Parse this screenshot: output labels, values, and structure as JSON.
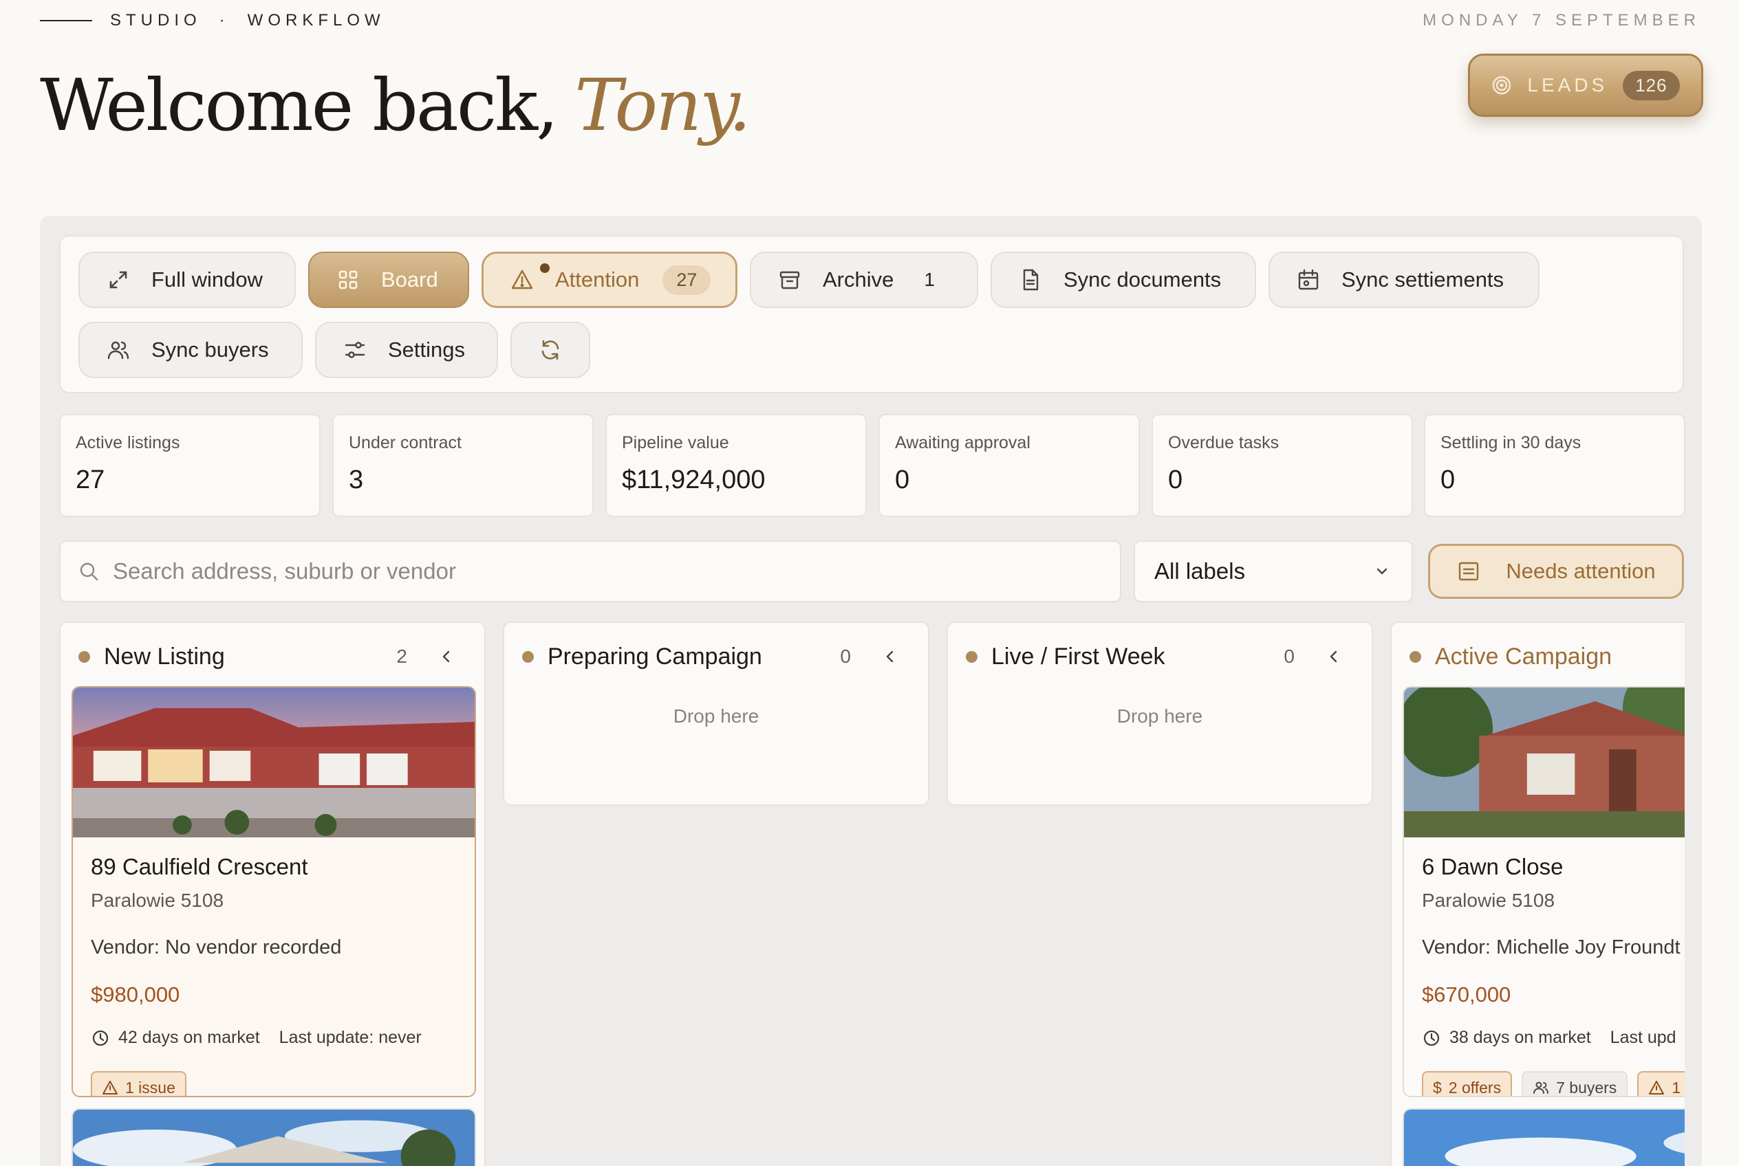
{
  "header": {
    "eyebrow_left": "STUDIO",
    "eyebrow_sep": "·",
    "eyebrow_right": "WORKFLOW",
    "date": "MONDAY 7 SEPTEMBER",
    "welcome": "Welcome back,",
    "user_name": "Tony.",
    "leads_label": "LEADS",
    "leads_count": "126"
  },
  "toolbar": {
    "full_window": "Full window",
    "board": "Board",
    "attention": "Attention",
    "attention_count": "27",
    "archive": "Archive",
    "archive_count": "1",
    "sync_documents": "Sync documents",
    "sync_settlements": "Sync settiements",
    "sync_buyers": "Sync buyers",
    "settings": "Settings"
  },
  "stats": [
    {
      "label": "Active listings",
      "value": "27"
    },
    {
      "label": "Under contract",
      "value": "3"
    },
    {
      "label": "Pipeline value",
      "value": "$11,924,000"
    },
    {
      "label": "Awaiting approval",
      "value": "0"
    },
    {
      "label": "Overdue tasks",
      "value": "0"
    },
    {
      "label": "Settling in 30 days",
      "value": "0"
    }
  ],
  "filters": {
    "search_placeholder": "Search address, suburb or vendor",
    "labels_selected": "All labels",
    "needs_attention": "Needs attention"
  },
  "columns": [
    {
      "title": "New Listing",
      "count": "2",
      "cards": [
        {
          "address": "89 Caulfield Crescent",
          "suburb": "Paralowie 5108",
          "vendor": "Vendor: No vendor recorded",
          "price": "$980,000",
          "days": "42 days on market",
          "last_update": "Last update: never",
          "issue_tag": "1 issue"
        }
      ]
    },
    {
      "title": "Preparing Campaign",
      "count": "0",
      "drop": "Drop here"
    },
    {
      "title": "Live / First Week",
      "count": "0",
      "drop": "Drop here"
    },
    {
      "title": "Active Campaign",
      "cards": [
        {
          "address": "6 Dawn Close",
          "suburb": "Paralowie 5108",
          "vendor": "Vendor: Michelle Joy Froundt",
          "price": "$670,000",
          "days": "38 days on market",
          "last_update": "Last upd",
          "offers_tag": "2 offers",
          "buyers_tag": "7 buyers",
          "issue_tag": "1"
        }
      ]
    }
  ],
  "colors": {
    "accent_gold": "#bf9a66",
    "price": "#a4531e",
    "background": "#fbf9f6"
  }
}
